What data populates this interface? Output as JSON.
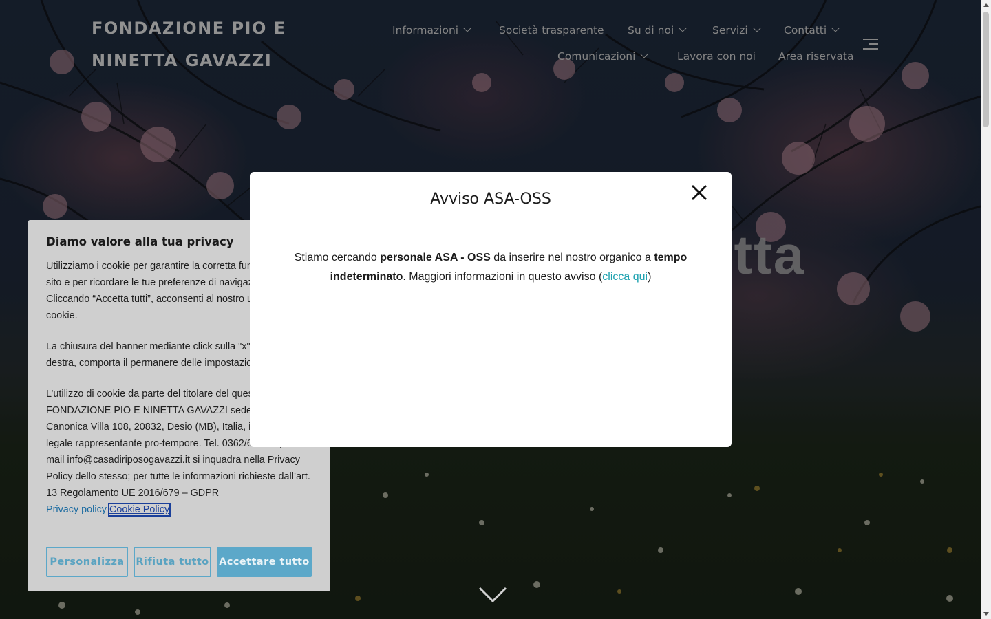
{
  "site": {
    "title_line1": "FONDAZIONE PIO E",
    "title_line2": "NINETTA GAVAZZI"
  },
  "nav": {
    "items": [
      {
        "label": "Informazioni",
        "has_dropdown": true
      },
      {
        "label": "Società trasparente",
        "has_dropdown": false
      },
      {
        "label": "Su di noi",
        "has_dropdown": true
      },
      {
        "label": "Servizi",
        "has_dropdown": true
      },
      {
        "label": "Contatti",
        "has_dropdown": true
      },
      {
        "label": "Comunicazioni",
        "has_dropdown": true
      },
      {
        "label": "Lavora con noi",
        "has_dropdown": false
      },
      {
        "label": "Area riservata",
        "has_dropdown": false
      }
    ],
    "menu_toggle_icon": "hamburger-menu-icon"
  },
  "hero": {
    "visible_text": "etta",
    "scroll_icon": "chevron-down-icon"
  },
  "modal": {
    "title": "Avviso ASA-OSS",
    "close_icon": "close-icon",
    "body_part1": "Stiamo cercando ",
    "body_bold1": "personale ASA - OSS",
    "body_part2": " da inserire nel nostro organico a ",
    "body_bold2": "tempo indeterminato",
    "body_part3": ". Maggiori informazioni in questo avviso (",
    "body_link": "clicca qui",
    "body_part4": ")"
  },
  "cookie_banner": {
    "title": "Diamo valore alla tua privacy",
    "paragraph1": "Utilizziamo i cookie per garantire la corretta funzionalità del sito e per ricordare le tue preferenze di navigazione. Cliccando “Accetta tutti”, acconsenti al nostro utilizzo dei cookie.",
    "paragraph2": "La chiusura del banner mediante click sulla \"x\" in alto a destra, comporta il permanere delle impostazioni di default.",
    "paragraph3": "L’utilizzo di cookie da parte del titolare del questo sito, FONDAZIONE PIO E NINETTA GAVAZZI sede in Via Canonica Villa 108, 20832, Desio (MB), Italia, in persona del legale rappresentante pro-tempore. Tel. 0362/616211, e-mail info@casadiriposogavazzi.it si inquadra nella Privacy Policy dello stesso; per tutte le informazioni richieste dall’art. 13 Regolamento UE 2016/679 – GDPR",
    "privacy_link": "Privacy policy",
    "cookie_link": "Cookie Policy",
    "buttons": {
      "customize": "Personalizza",
      "reject": "Rifiuta tutto",
      "accept": "Accettare tutto"
    }
  },
  "colors": {
    "accent": "#5ca8c9",
    "link": "#1ea2b0",
    "banner_bg": "#cfcfcf"
  }
}
